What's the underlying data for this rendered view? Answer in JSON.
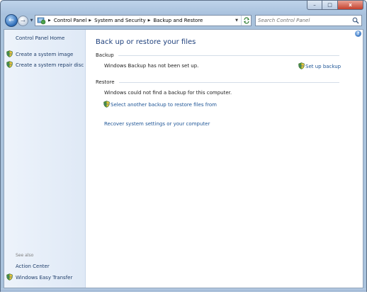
{
  "window": {
    "title": "",
    "minimize_label": "–",
    "maximize_label": "□",
    "close_label": "x"
  },
  "navigation": {
    "back_glyph": "←",
    "forward_glyph": "→",
    "history_glyph": "▼",
    "breadcrumb": [
      "Control Panel",
      "System and Security",
      "Backup and Restore"
    ],
    "separator_glyph": "▶",
    "dropdown_glyph": "▼",
    "search_placeholder": "Search Control Panel"
  },
  "sidebar": {
    "home_link": "Control Panel Home",
    "tasks": [
      "Create a system image",
      "Create a system repair disc"
    ],
    "see_also_label": "See also",
    "see_also_links": [
      "Action Center",
      "Windows Easy Transfer"
    ]
  },
  "main": {
    "help_glyph": "?",
    "title": "Back up or restore your files",
    "backup_section": {
      "heading": "Backup",
      "status": "Windows Backup has not been set up.",
      "setup_link": "Set up backup"
    },
    "restore_section": {
      "heading": "Restore",
      "status": "Windows could not find a backup for this computer.",
      "select_link": "Select another backup to restore files from"
    },
    "recover_link": "Recover system settings or your computer"
  },
  "colors": {
    "link": "#1e5596",
    "title": "#1d3f7b",
    "sidebar_link": "#1e3d69",
    "frame": "#a9c2dc"
  },
  "icons": {
    "nav_back": "back-arrow-icon",
    "nav_forward": "forward-arrow-icon",
    "address": "control-panel-icon",
    "refresh": "refresh-icon",
    "search": "search-icon",
    "tasks": "uac-shield-icon",
    "help": "help-icon"
  }
}
